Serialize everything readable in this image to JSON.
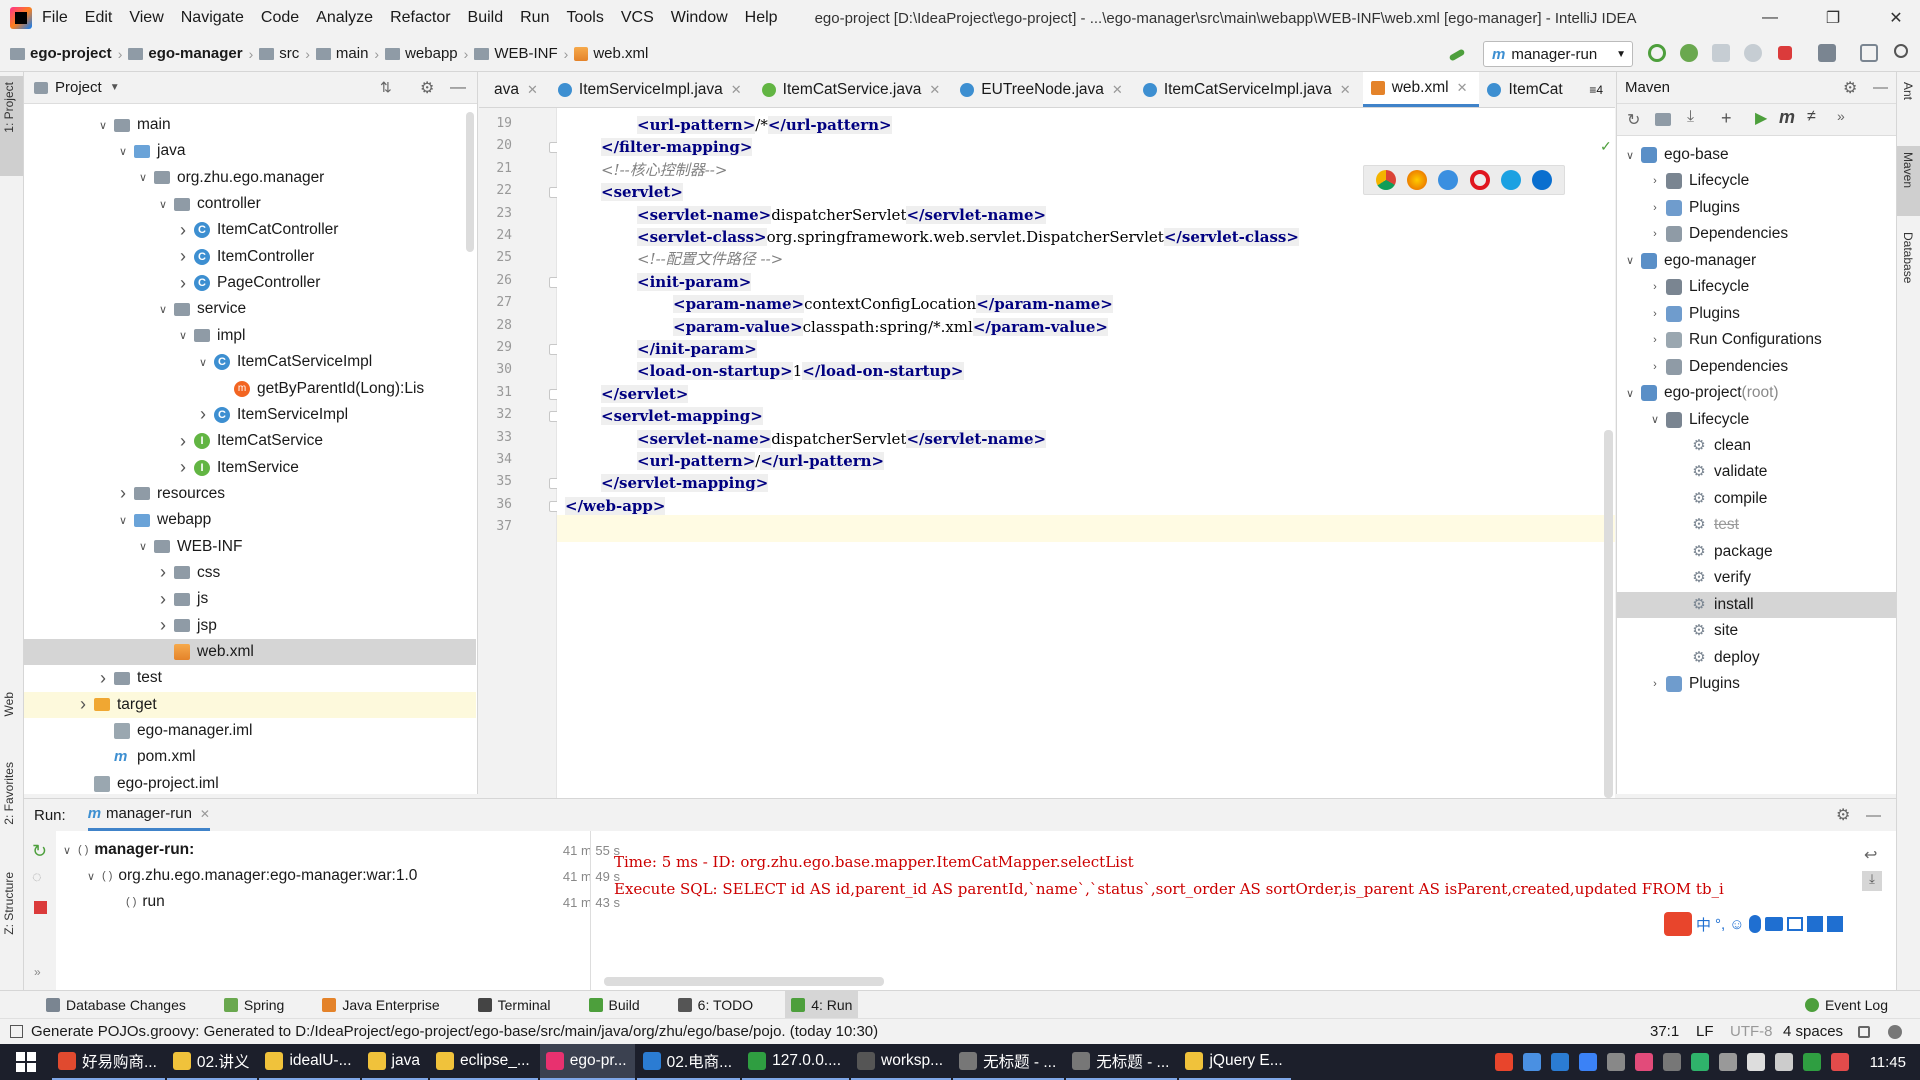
{
  "window": {
    "title": "ego-project [D:\\IdeaProject\\ego-project] - ...\\ego-manager\\src\\main\\webapp\\WEB-INF\\web.xml [ego-manager] - IntelliJ IDEA",
    "menu": [
      "File",
      "Edit",
      "View",
      "Navigate",
      "Code",
      "Analyze",
      "Refactor",
      "Build",
      "Run",
      "Tools",
      "VCS",
      "Window",
      "Help"
    ]
  },
  "breadcrumb": [
    "ego-project",
    "ego-manager",
    "src",
    "main",
    "webapp",
    "WEB-INF",
    "web.xml"
  ],
  "run_config": "manager-run",
  "project_panel": {
    "title": "Project",
    "tree": [
      {
        "label": "main",
        "depth": 3,
        "arrow": "open",
        "icon": "folder"
      },
      {
        "label": "java",
        "depth": 4,
        "arrow": "open",
        "icon": "folder-src"
      },
      {
        "label": "org.zhu.ego.manager",
        "depth": 5,
        "arrow": "open",
        "icon": "folder"
      },
      {
        "label": "controller",
        "depth": 6,
        "arrow": "open",
        "icon": "folder"
      },
      {
        "label": "ItemCatController",
        "depth": 7,
        "arrow": "closed",
        "icon": "class"
      },
      {
        "label": "ItemController",
        "depth": 7,
        "arrow": "closed",
        "icon": "class"
      },
      {
        "label": "PageController",
        "depth": 7,
        "arrow": "closed",
        "icon": "class"
      },
      {
        "label": "service",
        "depth": 6,
        "arrow": "open",
        "icon": "folder"
      },
      {
        "label": "impl",
        "depth": 7,
        "arrow": "open",
        "icon": "folder"
      },
      {
        "label": "ItemCatServiceImpl",
        "depth": 8,
        "arrow": "open",
        "icon": "class"
      },
      {
        "label": "getByParentId(Long):Lis",
        "depth": 9,
        "arrow": "none",
        "icon": "method"
      },
      {
        "label": "ItemServiceImpl",
        "depth": 8,
        "arrow": "closed",
        "icon": "class"
      },
      {
        "label": "ItemCatService",
        "depth": 7,
        "arrow": "closed",
        "icon": "interface"
      },
      {
        "label": "ItemService",
        "depth": 7,
        "arrow": "closed",
        "icon": "interface"
      },
      {
        "label": "resources",
        "depth": 4,
        "arrow": "closed",
        "icon": "folder"
      },
      {
        "label": "webapp",
        "depth": 4,
        "arrow": "open",
        "icon": "folder-src"
      },
      {
        "label": "WEB-INF",
        "depth": 5,
        "arrow": "open",
        "icon": "folder"
      },
      {
        "label": "css",
        "depth": 6,
        "arrow": "closed",
        "icon": "folder"
      },
      {
        "label": "js",
        "depth": 6,
        "arrow": "closed",
        "icon": "folder"
      },
      {
        "label": "jsp",
        "depth": 6,
        "arrow": "closed",
        "icon": "folder"
      },
      {
        "label": "web.xml",
        "depth": 6,
        "arrow": "none",
        "icon": "xml",
        "selected": true
      },
      {
        "label": "test",
        "depth": 3,
        "arrow": "closed",
        "icon": "folder"
      },
      {
        "label": "target",
        "depth": 2,
        "arrow": "closed",
        "icon": "folder-orange",
        "highlight": true
      },
      {
        "label": "ego-manager.iml",
        "depth": 3,
        "arrow": "none",
        "icon": "iml"
      },
      {
        "label": "pom.xml",
        "depth": 3,
        "arrow": "none",
        "icon": "pom"
      },
      {
        "label": "ego-project.iml",
        "depth": 2,
        "arrow": "none",
        "icon": "iml"
      }
    ]
  },
  "editor_tabs": [
    {
      "label": "ava",
      "icon": "none"
    },
    {
      "label": "ItemServiceImpl.java",
      "icon": "class"
    },
    {
      "label": "ItemCatService.java",
      "icon": "interface"
    },
    {
      "label": "EUTreeNode.java",
      "icon": "class"
    },
    {
      "label": "ItemCatServiceImpl.java",
      "icon": "class"
    },
    {
      "label": "web.xml",
      "icon": "xml",
      "active": true
    },
    {
      "label": "ItemCat",
      "icon": "class"
    }
  ],
  "tab_overflow": "≡4",
  "code_lines": [
    {
      "n": "19",
      "indent": 2,
      "parts": [
        [
          "tg",
          "<url-pattern>"
        ],
        [
          "tx",
          "/*"
        ],
        [
          "tg",
          "</url-pattern>"
        ]
      ]
    },
    {
      "n": "20",
      "indent": 1,
      "parts": [
        [
          "tg",
          "</filter-mapping>"
        ]
      ]
    },
    {
      "n": "21",
      "indent": 1,
      "parts": [
        [
          "cm",
          "<!--核心控制器-->"
        ]
      ]
    },
    {
      "n": "22",
      "indent": 1,
      "parts": [
        [
          "tg",
          "<servlet>"
        ]
      ]
    },
    {
      "n": "23",
      "indent": 2,
      "parts": [
        [
          "tg",
          "<servlet-name>"
        ],
        [
          "tx",
          "dispatcherServlet"
        ],
        [
          "tg",
          "</servlet-name>"
        ]
      ]
    },
    {
      "n": "24",
      "indent": 2,
      "parts": [
        [
          "tg",
          "<servlet-class>"
        ],
        [
          "tx",
          "org.springframework.web.servlet.DispatcherServlet"
        ],
        [
          "tg",
          "</servlet-class>"
        ]
      ]
    },
    {
      "n": "25",
      "indent": 2,
      "parts": [
        [
          "cm",
          "<!--配置文件路径 -->"
        ]
      ]
    },
    {
      "n": "26",
      "indent": 2,
      "parts": [
        [
          "tg",
          "<init-param>"
        ]
      ]
    },
    {
      "n": "27",
      "indent": 3,
      "parts": [
        [
          "tg",
          "<param-name>"
        ],
        [
          "tx",
          "contextConfigLocation"
        ],
        [
          "tg",
          "</param-name>"
        ]
      ]
    },
    {
      "n": "28",
      "indent": 3,
      "parts": [
        [
          "tg",
          "<param-value>"
        ],
        [
          "tx",
          "classpath:spring/*.xml"
        ],
        [
          "tg",
          "</param-value>"
        ]
      ]
    },
    {
      "n": "29",
      "indent": 2,
      "parts": [
        [
          "tg",
          "</init-param>"
        ]
      ]
    },
    {
      "n": "30",
      "indent": 2,
      "parts": [
        [
          "tg",
          "<load-on-startup>"
        ],
        [
          "tx",
          "1"
        ],
        [
          "tg",
          "</load-on-startup>"
        ]
      ]
    },
    {
      "n": "31",
      "indent": 1,
      "parts": [
        [
          "tg",
          "</servlet>"
        ]
      ]
    },
    {
      "n": "32",
      "indent": 1,
      "parts": [
        [
          "tg",
          "<servlet-mapping>"
        ]
      ]
    },
    {
      "n": "33",
      "indent": 2,
      "parts": [
        [
          "tg",
          "<servlet-name>"
        ],
        [
          "tx",
          "dispatcherServlet"
        ],
        [
          "tg",
          "</servlet-name>"
        ]
      ]
    },
    {
      "n": "34",
      "indent": 2,
      "parts": [
        [
          "tg",
          "<url-pattern>"
        ],
        [
          "tx",
          "/"
        ],
        [
          "tg",
          "</url-pattern>"
        ]
      ]
    },
    {
      "n": "35",
      "indent": 1,
      "parts": [
        [
          "tg",
          "</servlet-mapping>"
        ]
      ]
    },
    {
      "n": "36",
      "indent": 0,
      "parts": [
        [
          "tg",
          "</web-app>"
        ]
      ]
    },
    {
      "n": "37",
      "indent": 0,
      "parts": [],
      "current": true
    }
  ],
  "maven": {
    "title": "Maven",
    "tree": [
      {
        "label": "ego-base",
        "depth": 0,
        "arrow": "open",
        "icon": "module"
      },
      {
        "label": "Lifecycle",
        "depth": 1,
        "arrow": "closed",
        "icon": "lifecycle"
      },
      {
        "label": "Plugins",
        "depth": 1,
        "arrow": "closed",
        "icon": "plugins"
      },
      {
        "label": "Dependencies",
        "depth": 1,
        "arrow": "closed",
        "icon": "deps"
      },
      {
        "label": "ego-manager",
        "depth": 0,
        "arrow": "open",
        "icon": "module"
      },
      {
        "label": "Lifecycle",
        "depth": 1,
        "arrow": "closed",
        "icon": "lifecycle"
      },
      {
        "label": "Plugins",
        "depth": 1,
        "arrow": "closed",
        "icon": "plugins"
      },
      {
        "label": "Run Configurations",
        "depth": 1,
        "arrow": "closed",
        "icon": "runconf"
      },
      {
        "label": "Dependencies",
        "depth": 1,
        "arrow": "closed",
        "icon": "deps"
      },
      {
        "label": "ego-project",
        "suffix": " (root)",
        "depth": 0,
        "arrow": "open",
        "icon": "module"
      },
      {
        "label": "Lifecycle",
        "depth": 1,
        "arrow": "open",
        "icon": "lifecycle"
      },
      {
        "label": "clean",
        "depth": 2,
        "arrow": "none",
        "icon": "gear"
      },
      {
        "label": "validate",
        "depth": 2,
        "arrow": "none",
        "icon": "gear"
      },
      {
        "label": "compile",
        "depth": 2,
        "arrow": "none",
        "icon": "gear"
      },
      {
        "label": "test",
        "depth": 2,
        "arrow": "none",
        "icon": "gear",
        "strike": true
      },
      {
        "label": "package",
        "depth": 2,
        "arrow": "none",
        "icon": "gear"
      },
      {
        "label": "verify",
        "depth": 2,
        "arrow": "none",
        "icon": "gear"
      },
      {
        "label": "install",
        "depth": 2,
        "arrow": "none",
        "icon": "gear",
        "selected": true
      },
      {
        "label": "site",
        "depth": 2,
        "arrow": "none",
        "icon": "gear"
      },
      {
        "label": "deploy",
        "depth": 2,
        "arrow": "none",
        "icon": "gear"
      },
      {
        "label": "Plugins",
        "depth": 1,
        "arrow": "closed",
        "icon": "plugins"
      }
    ]
  },
  "run_panel": {
    "label": "Run:",
    "tab": "manager-run",
    "tree": [
      {
        "label": "manager-run:",
        "time": "41 m 55 s",
        "depth": 0,
        "bold": true
      },
      {
        "label": "org.zhu.ego.manager:ego-manager:war:1.0",
        "time": "41 m 49 s",
        "depth": 1
      },
      {
        "label": "run",
        "time": "41 m 43 s",
        "depth": 2
      }
    ],
    "console": [
      "Time: 5 ms - ID: org.zhu.ego.base.mapper.ItemCatMapper.selectList",
      "Execute SQL: SELECT id AS id,parent_id AS parentId,`name`,`status`,sort_order AS sortOrder,is_parent AS isParent,created,updated FROM tb_i"
    ]
  },
  "tool_windows": [
    "Database Changes",
    "Spring",
    "Java Enterprise",
    "Terminal",
    "Build",
    "6: TODO",
    "4: Run"
  ],
  "event_log": "Event Log",
  "status": {
    "message": "Generate POJOs.groovy: Generated to D:/IdeaProject/ego-project/ego-base/src/main/java/org/zhu/ego/base/pojo. (today 10:30)",
    "position": "37:1",
    "line_sep": "LF",
    "encoding": "UTF-8",
    "indent": "4 spaces"
  },
  "side_labels": {
    "project": "1: Project",
    "web": "Web",
    "favorites": "2: Favorites",
    "structure": "Z: Structure",
    "ant": "Ant",
    "maven": "Maven",
    "database": "Database"
  },
  "taskbar": [
    {
      "label": "好易购商...",
      "color": "#e04a2f"
    },
    {
      "label": "02.讲义",
      "color": "#f0c23b"
    },
    {
      "label": "idealU-...",
      "color": "#f0c23b"
    },
    {
      "label": "java",
      "color": "#f0c23b"
    },
    {
      "label": "eclipse_...",
      "color": "#f0c23b"
    },
    {
      "label": "ego-pr...",
      "color": "#e8316f",
      "active": true
    },
    {
      "label": "02.电商...",
      "color": "#2b7cd3"
    },
    {
      "label": "127.0.0....",
      "color": "#2f9e41"
    },
    {
      "label": "worksp...",
      "color": "#555555"
    },
    {
      "label": "无标题 - ...",
      "color": "#777777"
    },
    {
      "label": "无标题 - ...",
      "color": "#777777"
    },
    {
      "label": "jQuery E...",
      "color": "#f0c23b"
    }
  ],
  "clock": "11:45"
}
